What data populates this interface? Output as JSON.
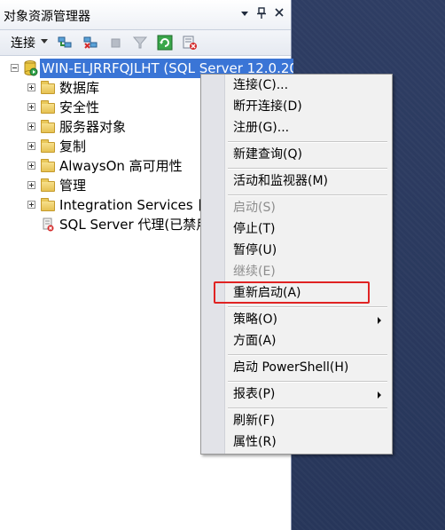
{
  "panel": {
    "title": "对象资源管理器",
    "pin_glyph": "↓",
    "pin2_glyph": "\u0002",
    "close_glyph": "×"
  },
  "toolbar": {
    "connect_label": "连接",
    "icons": [
      "connect-object-icon",
      "disconnect-icon",
      "stop-icon",
      "filter-icon",
      "refresh-icon",
      "summary-icon"
    ]
  },
  "tree": {
    "root": {
      "label": "WIN-ELJRRFQJLHT (SQL Server 12.0.20"
    },
    "children": [
      {
        "label": "数据库"
      },
      {
        "label": "安全性"
      },
      {
        "label": "服务器对象"
      },
      {
        "label": "复制"
      },
      {
        "label": "AlwaysOn 高可用性"
      },
      {
        "label": "管理"
      },
      {
        "label": "Integration Services 目"
      },
      {
        "label": "SQL Server 代理(已禁用"
      }
    ]
  },
  "context_menu": {
    "items": [
      {
        "label": "连接(C)...",
        "enabled": true
      },
      {
        "label": "断开连接(D)",
        "enabled": true
      },
      {
        "label": "注册(G)...",
        "enabled": true
      },
      {
        "label": "新建查询(Q)",
        "enabled": true
      },
      {
        "label": "活动和监视器(M)",
        "enabled": true
      },
      {
        "label": "启动(S)",
        "enabled": false
      },
      {
        "label": "停止(T)",
        "enabled": true
      },
      {
        "label": "暂停(U)",
        "enabled": true
      },
      {
        "label": "继续(E)",
        "enabled": false
      },
      {
        "label": "重新启动(A)",
        "enabled": true,
        "highlighted": true
      },
      {
        "label": "策略(O)",
        "enabled": true,
        "submenu": true
      },
      {
        "label": "方面(A)",
        "enabled": true
      },
      {
        "label": "启动 PowerShell(H)",
        "enabled": true
      },
      {
        "label": "报表(P)",
        "enabled": true,
        "submenu": true
      },
      {
        "label": "刷新(F)",
        "enabled": true
      },
      {
        "label": "属性(R)",
        "enabled": true
      }
    ]
  },
  "colors": {
    "selection": "#3a75d6",
    "highlight_box": "#e02323",
    "background": "#2b3a5e"
  }
}
